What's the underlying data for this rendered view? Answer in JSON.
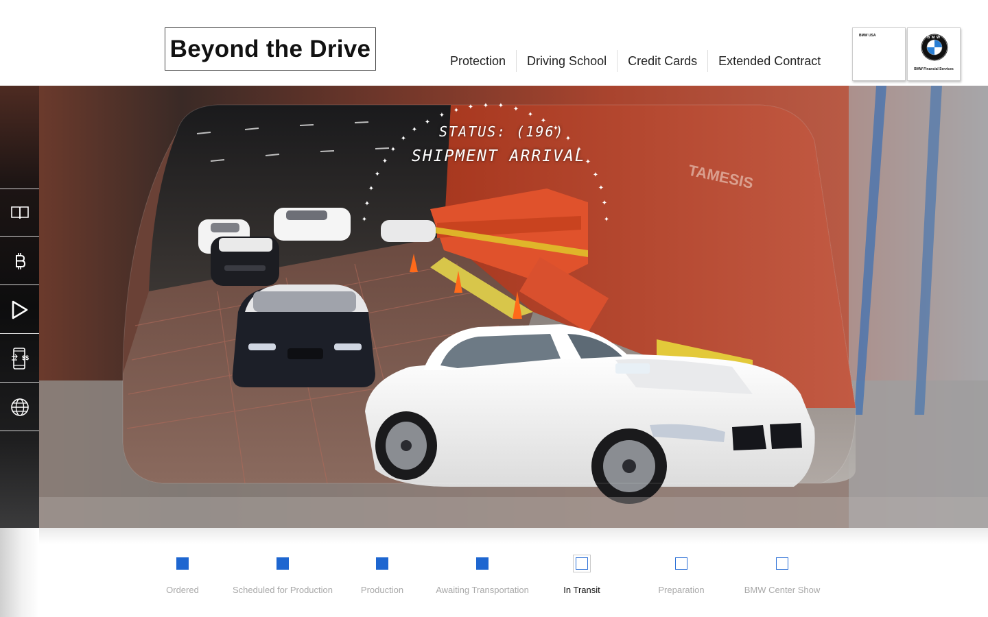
{
  "brand": {
    "title": "Beyond the Drive"
  },
  "nav": {
    "items": [
      "Protection",
      "Driving School",
      "Credit Cards",
      "Extended Contract"
    ]
  },
  "logos": {
    "usa_label": "BMW USA",
    "roundel_letters": "BMW",
    "financial_label": "BMW Financial Services"
  },
  "rail": {
    "items": [
      {
        "icon": "book-icon"
      },
      {
        "icon": "bitcoin-icon"
      },
      {
        "icon": "play-icon"
      },
      {
        "icon": "mobile-payment-icon",
        "text": "$$"
      },
      {
        "icon": "globe-icon"
      }
    ]
  },
  "hero": {
    "status_line": "STATUS: (196)",
    "status_title": "SHIPMENT ARRIVAL"
  },
  "tracker": {
    "current_index": 4,
    "steps": [
      {
        "label": "Ordered",
        "state": "done"
      },
      {
        "label": "Scheduled for Production",
        "state": "done"
      },
      {
        "label": "Production",
        "state": "done"
      },
      {
        "label": "Awaiting Transportation",
        "state": "done"
      },
      {
        "label": "In Transit",
        "state": "current"
      },
      {
        "label": "Preparation",
        "state": "todo"
      },
      {
        "label": "BMW Center Show",
        "state": "todo"
      }
    ]
  },
  "colors": {
    "accent_blue": "#1e66d0",
    "ship_red": "#b8452e"
  }
}
